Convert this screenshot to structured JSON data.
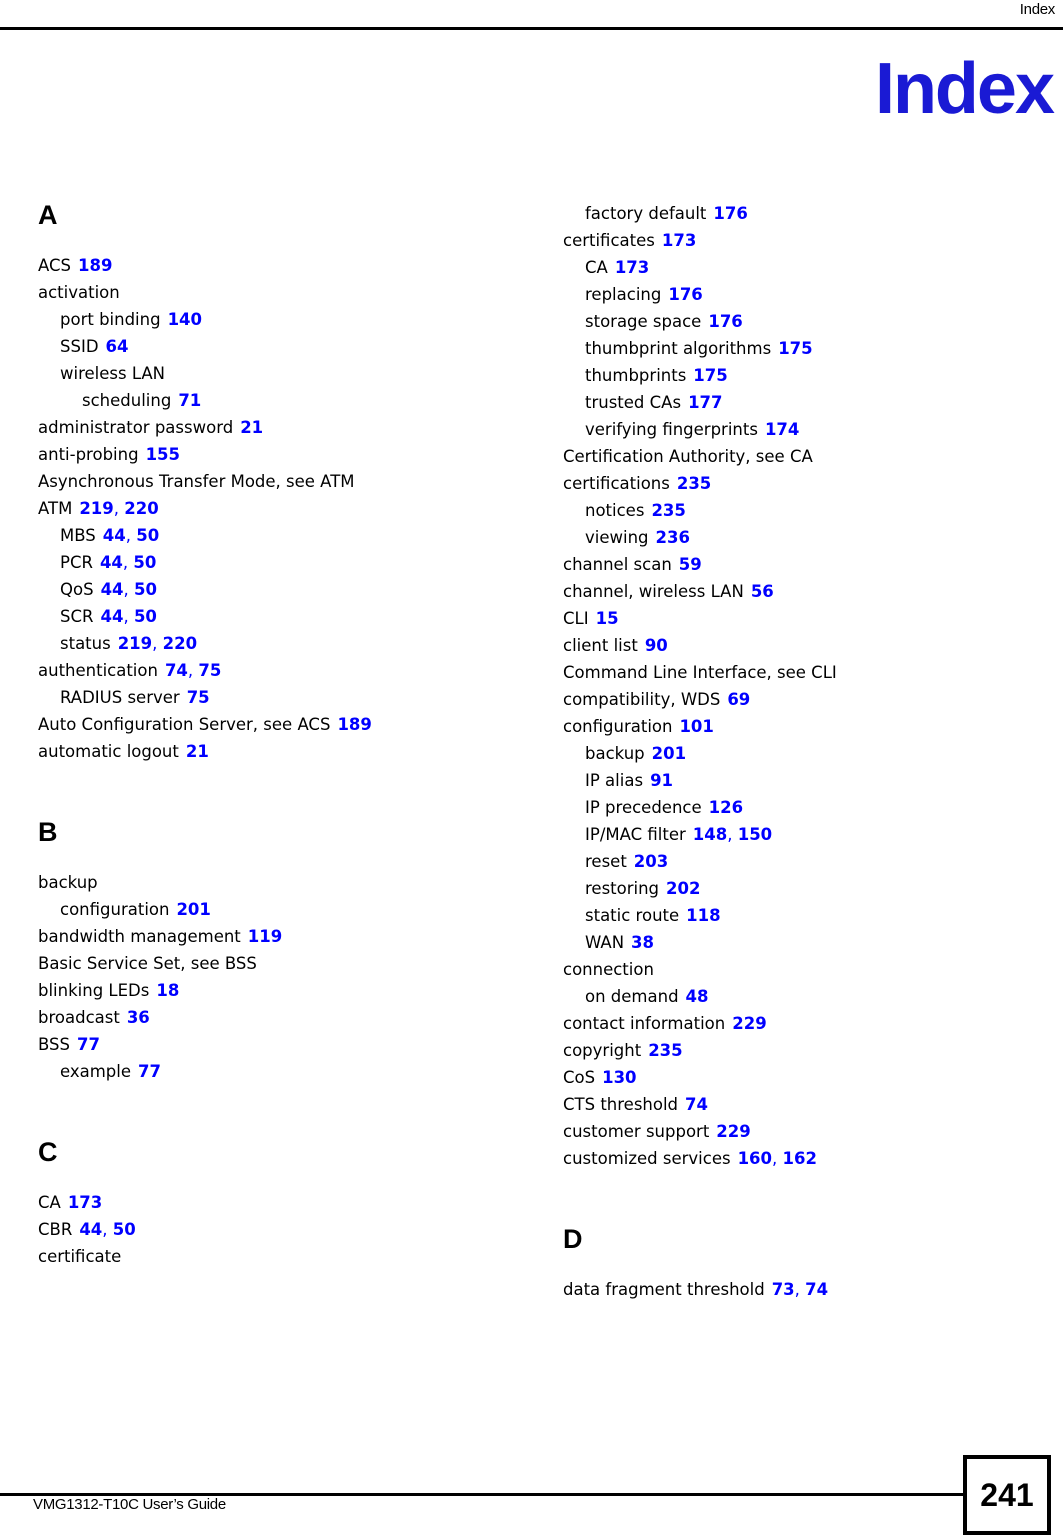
{
  "header": {
    "running_head": "Index",
    "chapter_title": "Index"
  },
  "footer": {
    "guide_title": "VMG1312-T10C User’s Guide",
    "page_number": "241"
  },
  "columns": [
    {
      "name": "left-column",
      "blocks": [
        {
          "letter": "A",
          "entries": [
            {
              "level": 0,
              "term": "ACS",
              "pages": "189"
            },
            {
              "level": 0,
              "term": "activation",
              "pages": ""
            },
            {
              "level": 1,
              "term": "port binding",
              "pages": "140"
            },
            {
              "level": 1,
              "term": "SSID",
              "pages": "64"
            },
            {
              "level": 1,
              "term": "wireless LAN",
              "pages": ""
            },
            {
              "level": 2,
              "term": "scheduling",
              "pages": "71"
            },
            {
              "level": 0,
              "term": "administrator password",
              "pages": "21"
            },
            {
              "level": 0,
              "term": "anti-probing",
              "pages": "155"
            },
            {
              "level": 0,
              "term": "Asynchronous Transfer Mode, see ATM",
              "pages": ""
            },
            {
              "level": 0,
              "term": "ATM",
              "pages": "219, 220"
            },
            {
              "level": 1,
              "term": "MBS",
              "pages": "44, 50"
            },
            {
              "level": 1,
              "term": "PCR",
              "pages": "44, 50"
            },
            {
              "level": 1,
              "term": "QoS",
              "pages": "44, 50"
            },
            {
              "level": 1,
              "term": "SCR",
              "pages": "44, 50"
            },
            {
              "level": 1,
              "term": "status",
              "pages": "219, 220"
            },
            {
              "level": 0,
              "term": "authentication",
              "pages": "74, 75"
            },
            {
              "level": 1,
              "term": "RADIUS server",
              "pages": "75"
            },
            {
              "level": 0,
              "term": "Auto Configuration Server, see ACS",
              "pages": "189"
            },
            {
              "level": 0,
              "term": "automatic logout",
              "pages": "21"
            }
          ]
        },
        {
          "letter": "B",
          "entries": [
            {
              "level": 0,
              "term": "backup",
              "pages": ""
            },
            {
              "level": 1,
              "term": "configuration",
              "pages": "201"
            },
            {
              "level": 0,
              "term": "bandwidth management",
              "pages": "119"
            },
            {
              "level": 0,
              "term": "Basic Service Set, see BSS",
              "pages": ""
            },
            {
              "level": 0,
              "term": "blinking LEDs",
              "pages": "18"
            },
            {
              "level": 0,
              "term": "broadcast",
              "pages": "36"
            },
            {
              "level": 0,
              "term": "BSS",
              "pages": "77"
            },
            {
              "level": 1,
              "term": "example",
              "pages": "77"
            }
          ]
        },
        {
          "letter": "C",
          "entries": [
            {
              "level": 0,
              "term": "CA",
              "pages": "173"
            },
            {
              "level": 0,
              "term": "CBR",
              "pages": "44, 50"
            },
            {
              "level": 0,
              "term": "certificate",
              "pages": ""
            }
          ]
        }
      ]
    },
    {
      "name": "right-column",
      "blocks": [
        {
          "letter": "",
          "entries": [
            {
              "level": 1,
              "term": "factory default",
              "pages": "176"
            },
            {
              "level": 0,
              "term": "certificates",
              "pages": "173"
            },
            {
              "level": 1,
              "term": "CA",
              "pages": "173"
            },
            {
              "level": 1,
              "term": "replacing",
              "pages": "176"
            },
            {
              "level": 1,
              "term": "storage space",
              "pages": "176"
            },
            {
              "level": 1,
              "term": "thumbprint algorithms",
              "pages": "175"
            },
            {
              "level": 1,
              "term": "thumbprints",
              "pages": "175"
            },
            {
              "level": 1,
              "term": "trusted CAs",
              "pages": "177"
            },
            {
              "level": 1,
              "term": "verifying fingerprints",
              "pages": "174"
            },
            {
              "level": 0,
              "term": "Certification Authority, see CA",
              "pages": ""
            },
            {
              "level": 0,
              "term": "certifications",
              "pages": "235"
            },
            {
              "level": 1,
              "term": "notices",
              "pages": "235"
            },
            {
              "level": 1,
              "term": "viewing",
              "pages": "236"
            },
            {
              "level": 0,
              "term": "channel scan",
              "pages": "59"
            },
            {
              "level": 0,
              "term": "channel, wireless LAN",
              "pages": "56"
            },
            {
              "level": 0,
              "term": "CLI",
              "pages": "15"
            },
            {
              "level": 0,
              "term": "client list",
              "pages": "90"
            },
            {
              "level": 0,
              "term": "Command Line Interface, see CLI",
              "pages": ""
            },
            {
              "level": 0,
              "term": "compatibility, WDS",
              "pages": "69"
            },
            {
              "level": 0,
              "term": "configuration",
              "pages": "101"
            },
            {
              "level": 1,
              "term": "backup",
              "pages": "201"
            },
            {
              "level": 1,
              "term": "IP alias",
              "pages": "91"
            },
            {
              "level": 1,
              "term": "IP precedence",
              "pages": "126"
            },
            {
              "level": 1,
              "term": "IP/MAC filter",
              "pages": "148, 150"
            },
            {
              "level": 1,
              "term": "reset",
              "pages": "203"
            },
            {
              "level": 1,
              "term": "restoring",
              "pages": "202"
            },
            {
              "level": 1,
              "term": "static route",
              "pages": "118"
            },
            {
              "level": 1,
              "term": "WAN",
              "pages": "38"
            },
            {
              "level": 0,
              "term": "connection",
              "pages": ""
            },
            {
              "level": 1,
              "term": "on demand",
              "pages": "48"
            },
            {
              "level": 0,
              "term": "contact information",
              "pages": "229"
            },
            {
              "level": 0,
              "term": "copyright",
              "pages": "235"
            },
            {
              "level": 0,
              "term": "CoS",
              "pages": "130"
            },
            {
              "level": 0,
              "term": "CTS threshold",
              "pages": "74"
            },
            {
              "level": 0,
              "term": "customer support",
              "pages": "229"
            },
            {
              "level": 0,
              "term": "customized services",
              "pages": "160, 162"
            }
          ]
        },
        {
          "letter": "D",
          "entries": [
            {
              "level": 0,
              "term": "data fragment threshold",
              "pages": "73, 74"
            }
          ]
        }
      ]
    }
  ],
  "colors": {
    "page_number_link": "#0000ff",
    "chapter_title": "#1a1ad4",
    "rule": "#000000"
  }
}
